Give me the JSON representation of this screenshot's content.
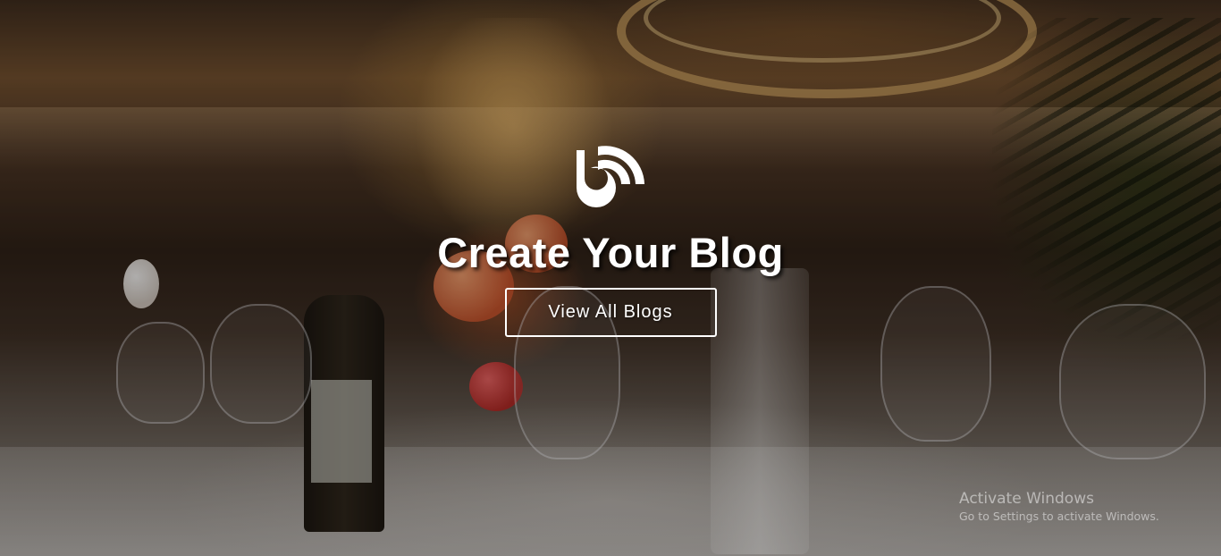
{
  "hero": {
    "logo_icon": "blog-broadcast-logo-icon",
    "title": "Create Your Blog",
    "cta_label": "View All Blogs"
  },
  "watermark": {
    "title": "Activate Windows",
    "subtitle": "Go to Settings to activate Windows."
  },
  "colors": {
    "text": "#ffffff",
    "button_border": "#ffffff",
    "overlay": "#000000"
  }
}
